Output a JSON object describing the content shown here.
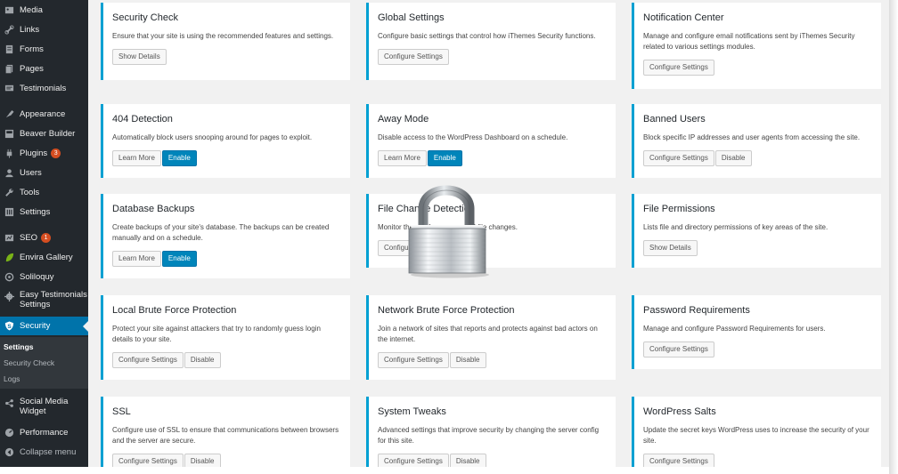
{
  "sidebar": {
    "items": [
      {
        "label": "Media",
        "icon": "media-icon"
      },
      {
        "label": "Links",
        "icon": "links-icon"
      },
      {
        "label": "Forms",
        "icon": "forms-icon"
      },
      {
        "label": "Pages",
        "icon": "pages-icon"
      },
      {
        "label": "Testimonials",
        "icon": "testimonials-icon"
      },
      {
        "label": "Appearance",
        "icon": "appearance-icon"
      },
      {
        "label": "Beaver Builder",
        "icon": "beaver-builder-icon"
      },
      {
        "label": "Plugins",
        "icon": "plugins-icon",
        "badge": "3"
      },
      {
        "label": "Users",
        "icon": "users-icon"
      },
      {
        "label": "Tools",
        "icon": "tools-icon"
      },
      {
        "label": "Settings",
        "icon": "settings-icon"
      },
      {
        "label": "SEO",
        "icon": "seo-icon",
        "badge": "1"
      },
      {
        "label": "Envira Gallery",
        "icon": "envira-gallery-icon"
      },
      {
        "label": "Soliloquy",
        "icon": "soliloquy-icon"
      },
      {
        "label": "Easy Testimonials Settings",
        "line1": "Easy Testimonials",
        "line2": "Settings",
        "icon": "easy-testimonials-icon"
      },
      {
        "label": "Security",
        "icon": "security-shield-icon"
      },
      {
        "label": "Social Media Widget",
        "line1": "Social Media",
        "line2": "Widget",
        "icon": "social-media-icon"
      },
      {
        "label": "Performance",
        "icon": "performance-icon"
      },
      {
        "label": "Collapse menu",
        "icon": "collapse-icon"
      }
    ],
    "submenu": [
      "Settings",
      "Security Check",
      "Logs"
    ]
  },
  "cards": [
    {
      "title": "Security Check",
      "desc": "Ensure that your site is using the recommended features and settings.",
      "buttons": [
        "Show Details"
      ]
    },
    {
      "title": "Global Settings",
      "desc": "Configure basic settings that control how iThemes Security functions.",
      "buttons": [
        "Configure Settings"
      ]
    },
    {
      "title": "Notification Center",
      "desc": "Manage and configure email notifications sent by iThemes Security related to various settings modules.",
      "buttons": [
        "Configure Settings"
      ]
    },
    {
      "title": "404 Detection",
      "desc": "Automatically block users snooping around for pages to exploit.",
      "buttons": [
        "Learn More",
        "Enable"
      ]
    },
    {
      "title": "Away Mode",
      "desc": "Disable access to the WordPress Dashboard on a schedule.",
      "buttons": [
        "Learn More",
        "Enable"
      ]
    },
    {
      "title": "Banned Users",
      "desc": "Block specific IP addresses and user agents from accessing the site.",
      "buttons": [
        "Configure Settings",
        "Disable"
      ]
    },
    {
      "title": "Database Backups",
      "desc": "Create backups of your site's database. The backups can be created manually and on a schedule.",
      "buttons": [
        "Learn More",
        "Enable"
      ]
    },
    {
      "title": "File Change Detection",
      "desc": "Monitor the site for unexpected file changes.",
      "buttons": [
        "Configure Settings"
      ]
    },
    {
      "title": "File Permissions",
      "desc": "Lists file and directory permissions of key areas of the site.",
      "buttons": [
        "Show Details"
      ]
    },
    {
      "title": "Local Brute Force Protection",
      "desc": "Protect your site against attackers that try to randomly guess login details to your site.",
      "buttons": [
        "Configure Settings",
        "Disable"
      ]
    },
    {
      "title": "Network Brute Force Protection",
      "desc": "Join a network of sites that reports and protects against bad actors on the internet.",
      "buttons": [
        "Configure Settings",
        "Disable"
      ]
    },
    {
      "title": "Password Requirements",
      "desc": "Manage and configure Password Requirements for users.",
      "buttons": [
        "Configure Settings"
      ]
    },
    {
      "title": "SSL",
      "desc": "Configure use of SSL to ensure that communications between browsers and the server are secure.",
      "buttons": [
        "Configure Settings",
        "Disable"
      ]
    },
    {
      "title": "System Tweaks",
      "desc": "Advanced settings that improve security by changing the server config for this site.",
      "buttons": [
        "Configure Settings",
        "Disable"
      ]
    },
    {
      "title": "WordPress Salts",
      "desc": "Update the secret keys WordPress uses to increase the security of your site.",
      "buttons": [
        "Configure Settings"
      ]
    }
  ],
  "overlay": {
    "icon": "padlock-icon"
  },
  "colors": {
    "accent": "#00a0d2",
    "primary_button": "#0085ba",
    "sidebar_bg": "#23282d",
    "active_menu": "#0073aa",
    "badge": "#d54e21"
  }
}
